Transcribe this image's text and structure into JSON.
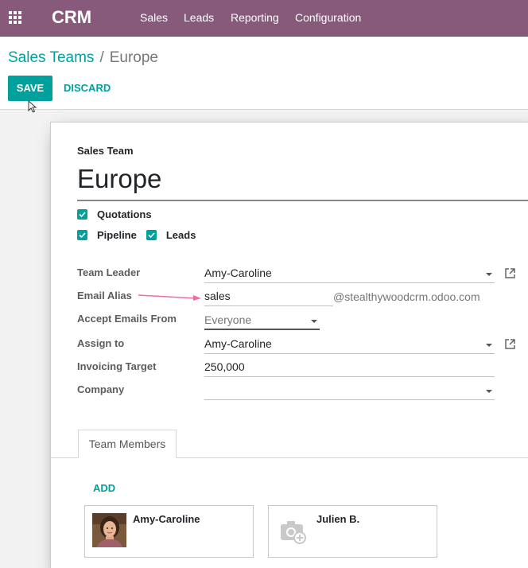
{
  "navbar": {
    "app_title": "CRM",
    "menu": [
      "Sales",
      "Leads",
      "Reporting",
      "Configuration"
    ]
  },
  "breadcrumb": {
    "parent": "Sales Teams",
    "separator": "/",
    "current": "Europe"
  },
  "actions": {
    "save": "SAVE",
    "discard": "DISCARD"
  },
  "form": {
    "sales_team_label": "Sales Team",
    "team_name": "Europe",
    "checkboxes": [
      {
        "label": "Quotations",
        "checked": true
      },
      {
        "label": "Pipeline",
        "checked": true
      },
      {
        "label": "Leads",
        "checked": true
      }
    ],
    "fields": {
      "team_leader": {
        "label": "Team Leader",
        "value": "Amy-Caroline"
      },
      "email_alias": {
        "label": "Email Alias",
        "value": "sales",
        "domain": "@stealthywoodcrm.odoo.com"
      },
      "accept_emails": {
        "label": "Accept Emails From",
        "value": "Everyone"
      },
      "assign_to": {
        "label": "Assign to",
        "value": "Amy-Caroline"
      },
      "invoicing_target": {
        "label": "Invoicing Target",
        "value": "250,000"
      },
      "company": {
        "label": "Company",
        "value": ""
      }
    }
  },
  "notebook": {
    "tab": "Team Members",
    "add_label": "ADD",
    "members": [
      {
        "name": "Amy-Caroline",
        "avatar": "photo"
      },
      {
        "name": "Julien B.",
        "avatar": "camera-placeholder-icon"
      }
    ]
  },
  "colors": {
    "navbar": "#875a7b",
    "accent": "#00a09d",
    "arrow": "#f06ba8"
  }
}
